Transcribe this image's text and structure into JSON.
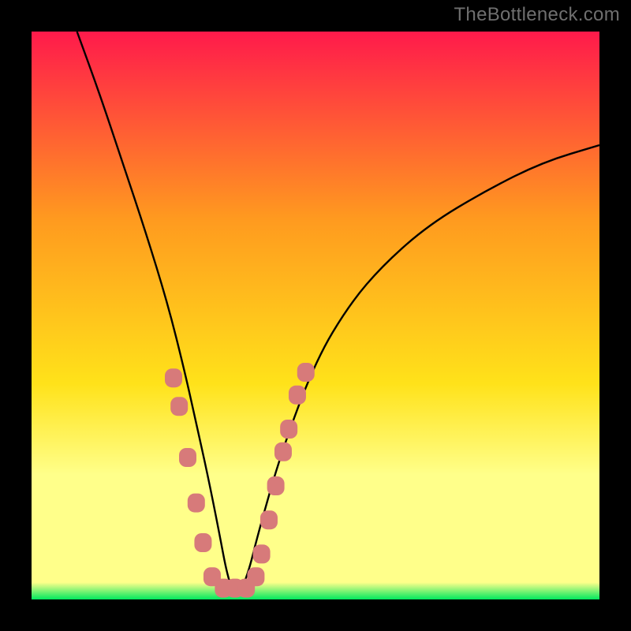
{
  "watermark": "TheBottleneck.com",
  "colors": {
    "frame": "#000000",
    "curve": "#000000",
    "markers": "#d77a7a",
    "gradient_top": "#ff1a4b",
    "gradient_mid1": "#ff9a1f",
    "gradient_mid2": "#ffe21a",
    "gradient_band": "#ffff8a",
    "gradient_bottom": "#00e85e"
  },
  "chart_data": {
    "type": "line",
    "title": "",
    "xlabel": "",
    "ylabel": "",
    "xlim": [
      0,
      100
    ],
    "ylim": [
      0,
      100
    ],
    "series": [
      {
        "name": "bottleneck-curve",
        "x": [
          8,
          12,
          16,
          20,
          24,
          27,
          29,
          31,
          33,
          34.5,
          36,
          38,
          40,
          44,
          50,
          56,
          62,
          70,
          80,
          90,
          100
        ],
        "y": [
          100,
          89,
          77,
          65,
          52,
          40,
          31,
          22,
          12,
          4,
          0,
          4,
          12,
          26,
          42,
          52,
          59,
          66,
          72,
          77,
          80
        ]
      }
    ],
    "markers": {
      "name": "sample-points",
      "points": [
        {
          "x": 25.0,
          "y": 39
        },
        {
          "x": 26.0,
          "y": 34
        },
        {
          "x": 27.5,
          "y": 25
        },
        {
          "x": 29.0,
          "y": 17
        },
        {
          "x": 30.2,
          "y": 10
        },
        {
          "x": 31.8,
          "y": 4
        },
        {
          "x": 33.8,
          "y": 2
        },
        {
          "x": 35.8,
          "y": 2
        },
        {
          "x": 37.8,
          "y": 2
        },
        {
          "x": 39.5,
          "y": 4
        },
        {
          "x": 40.5,
          "y": 8
        },
        {
          "x": 41.8,
          "y": 14
        },
        {
          "x": 43.0,
          "y": 20
        },
        {
          "x": 44.3,
          "y": 26
        },
        {
          "x": 45.3,
          "y": 30
        },
        {
          "x": 46.8,
          "y": 36
        },
        {
          "x": 48.3,
          "y": 40
        }
      ]
    }
  }
}
